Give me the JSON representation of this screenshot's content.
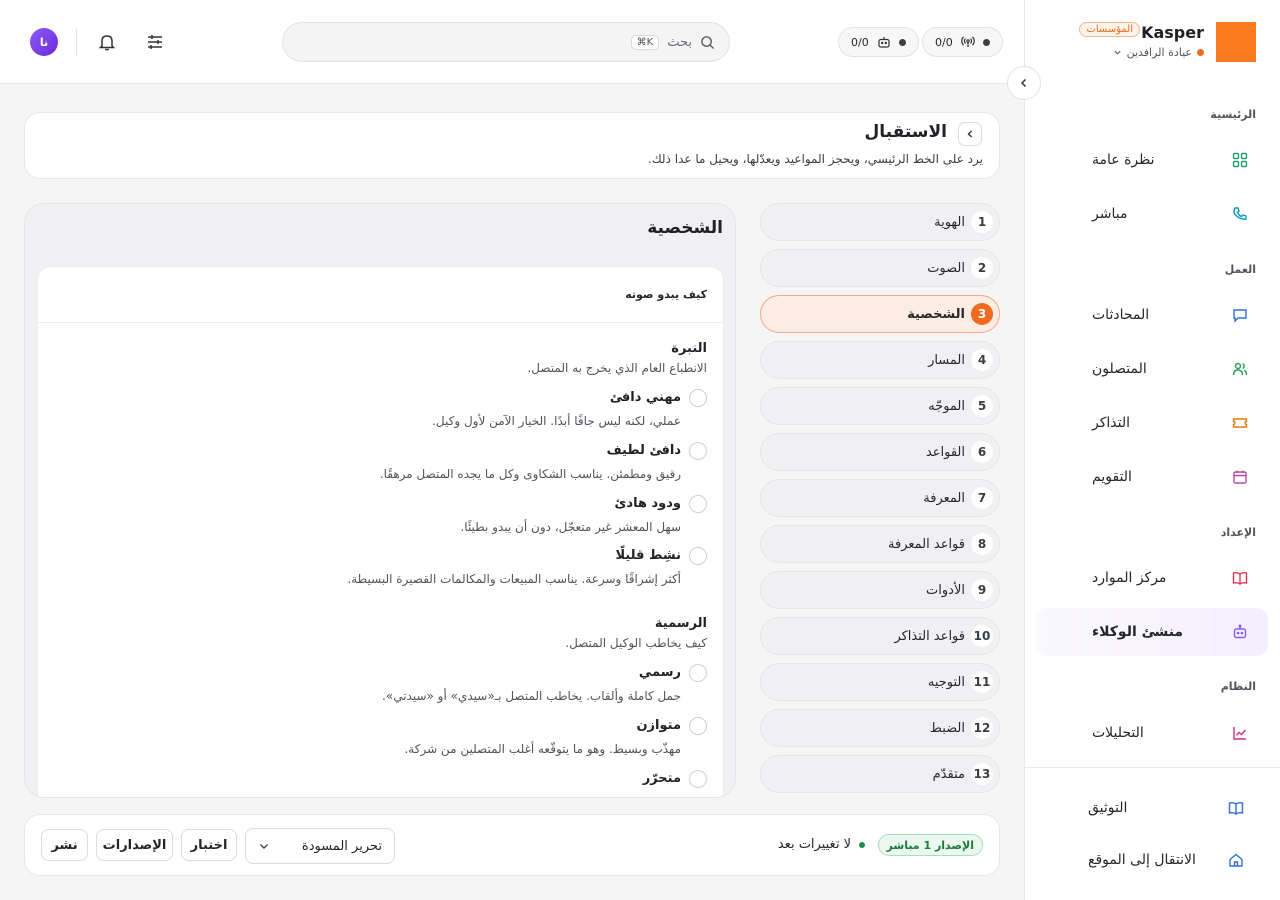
{
  "brand": {
    "name": "Kasper",
    "badge": "المؤسسات",
    "clinic": "عيادة الرافدين",
    "logo_color": "#fb7c1f"
  },
  "sidebar": {
    "sections": {
      "main": "الرئيسية",
      "work": "العمل",
      "setup": "الإعداد",
      "system": "النظام"
    },
    "items": [
      {
        "label": "نظرة عامة",
        "icon": "grid-icon",
        "color": "#22a06b"
      },
      {
        "label": "مباشر",
        "icon": "phone-icon",
        "color": "#0e9bb6"
      },
      {
        "label": "المحادثات",
        "icon": "chat-icon",
        "color": "#2f6fd6"
      },
      {
        "label": "المتصلون",
        "icon": "users-icon",
        "color": "#2e9e55"
      },
      {
        "label": "التذاكر",
        "icon": "ticket-icon",
        "color": "#e07b12"
      },
      {
        "label": "التقويم",
        "icon": "calendar-icon",
        "color": "#b44aa8"
      },
      {
        "label": "مركز الموارد",
        "icon": "book-icon",
        "color": "#e0344e"
      },
      {
        "label": "منشئ الوكلاء",
        "icon": "bot-icon",
        "color": "#8b5cf6"
      },
      {
        "label": "التحليلات",
        "icon": "chart-icon",
        "color": "#d6327a"
      },
      {
        "label": "التوثيق",
        "icon": "docs-icon",
        "color": "#2f6fd6"
      },
      {
        "label": "الانتقال إلى الموقع",
        "icon": "home-icon",
        "color": "#2f6fd6"
      }
    ]
  },
  "header": {
    "stat_calls": "0/0",
    "stat_bots": "0/0",
    "search_placeholder": "بحث",
    "search_shortcut": "⌘K",
    "avatar_initials": "نا"
  },
  "page": {
    "title": "الاستقبال",
    "description": "يرد على الخط الرئيسي، ويحجز المواعيد ويعدّلها، ويحيل ما عدا ذلك."
  },
  "steps": [
    {
      "num": "1",
      "label": "الهوية"
    },
    {
      "num": "2",
      "label": "الصوت"
    },
    {
      "num": "3",
      "label": "الشخصية",
      "active": true
    },
    {
      "num": "4",
      "label": "المسار"
    },
    {
      "num": "5",
      "label": "الموجّه"
    },
    {
      "num": "6",
      "label": "القواعد"
    },
    {
      "num": "7",
      "label": "المعرفة"
    },
    {
      "num": "8",
      "label": "قواعد المعرفة"
    },
    {
      "num": "9",
      "label": "الأدوات"
    },
    {
      "num": "10",
      "label": "قواعد التذاكر"
    },
    {
      "num": "11",
      "label": "التوجيه"
    },
    {
      "num": "12",
      "label": "الضبط"
    },
    {
      "num": "13",
      "label": "متقدّم"
    }
  ],
  "persona": {
    "title": "الشخصية",
    "subtitle": "كيف يبدو صوته",
    "tone": {
      "title": "النبرة",
      "description": "الانطباع العام الذي يخرج به المتصل.",
      "options": [
        {
          "label": "مهني دافئ",
          "description": "عملي، لكنه ليس جافًا أبدًا. الخيار الآمن لأول وكيل."
        },
        {
          "label": "دافئ لطيف",
          "description": "رقيق ومطمئن. يناسب الشكاوى وكل ما يجده المتصل مرهقًا."
        },
        {
          "label": "ودود هادئ",
          "description": "سهل المعشر غير متعجّل، دون أن يبدو بطيئًا."
        },
        {
          "label": "نشِط قليلًا",
          "description": "أكثر إشراقًا وسرعة. يناسب المبيعات والمكالمات القصيرة البسيطة."
        }
      ]
    },
    "formality": {
      "title": "الرسمية",
      "description": "كيف يخاطب الوكيل المتصل.",
      "options": [
        {
          "label": "رسمي",
          "description": "جمل كاملة وألقاب. يخاطب المتصل بـ«سيدي» أو «سيدتي»."
        },
        {
          "label": "متوازن",
          "description": "مهذّب وبسيط. وهو ما يتوقّعه أغلب المتصلين من شركة."
        },
        {
          "label": "متحرّر",
          "description": ""
        }
      ]
    }
  },
  "footer": {
    "version_badge": "الإصدار 1 مباشر",
    "status": "لا تغييرات بعد",
    "draft_select": "تحرير المسودة",
    "test_button": "اختبار",
    "versions_button": "الإصدارات",
    "publish_button": "نشر"
  }
}
